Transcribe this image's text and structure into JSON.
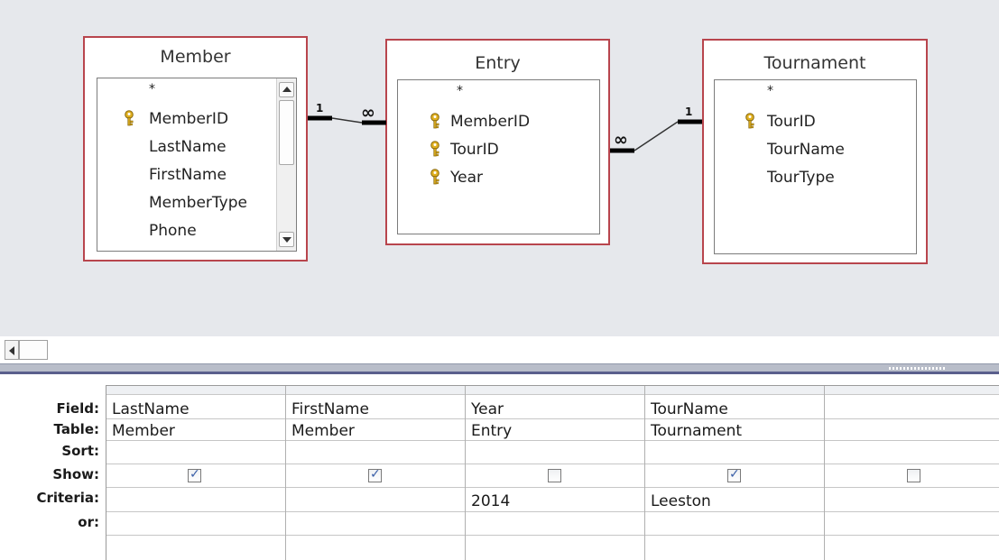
{
  "tables": [
    {
      "name": "Member",
      "fields": [
        "*",
        "MemberID",
        "LastName",
        "FirstName",
        "MemberType",
        "Phone"
      ],
      "key_fields": [
        "MemberID"
      ]
    },
    {
      "name": "Entry",
      "fields": [
        "*",
        "MemberID",
        "TourID",
        "Year"
      ],
      "key_fields": [
        "MemberID",
        "TourID",
        "Year"
      ]
    },
    {
      "name": "Tournament",
      "fields": [
        "*",
        "TourID",
        "TourName",
        "TourType"
      ],
      "key_fields": [
        "TourID"
      ]
    }
  ],
  "relationships": [
    {
      "from": "Member",
      "to": "Entry",
      "one_label": "1",
      "many_label": "∞"
    },
    {
      "from": "Tournament",
      "to": "Entry",
      "one_label": "1",
      "many_label": "∞"
    }
  ],
  "grid": {
    "row_labels": {
      "field": "Field:",
      "table": "Table:",
      "sort": "Sort:",
      "show": "Show:",
      "criteria": "Criteria:",
      "or": "or:"
    },
    "columns": [
      {
        "field": "LastName",
        "table": "Member",
        "sort": "",
        "show": true,
        "criteria": ""
      },
      {
        "field": "FirstName",
        "table": "Member",
        "sort": "",
        "show": true,
        "criteria": ""
      },
      {
        "field": "Year",
        "table": "Entry",
        "sort": "",
        "show": false,
        "criteria": "2014"
      },
      {
        "field": "TourName",
        "table": "Tournament",
        "sort": "",
        "show": true,
        "criteria": "Leeston"
      },
      {
        "field": "",
        "table": "",
        "sort": "",
        "show": false,
        "criteria": ""
      }
    ]
  },
  "icons": {
    "primary_key": "key-icon",
    "checkbox_checked": "checkmark-icon"
  },
  "colors": {
    "table_border": "#b8454d",
    "design_background": "#e6e8ec",
    "key_fill": "#e0b020",
    "check_mark": "#3a5fa8",
    "splitter": "#5a5f8c"
  }
}
